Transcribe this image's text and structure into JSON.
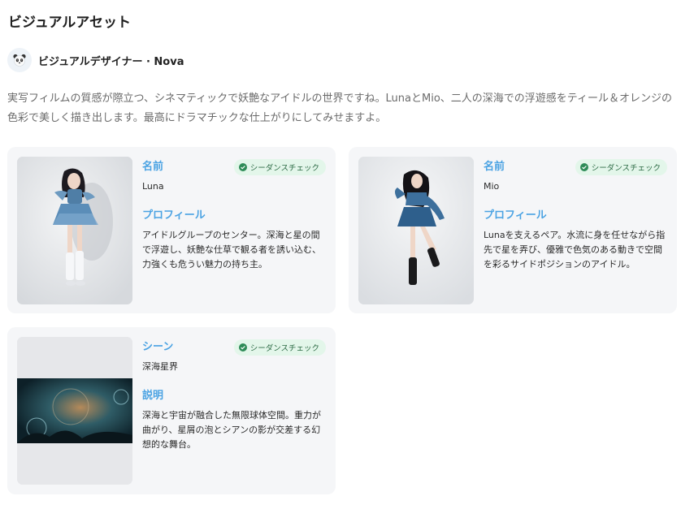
{
  "section": {
    "title": "ビジュアルアセット"
  },
  "designer": {
    "avatar_icon": "panda-icon",
    "name": "ビジュアルデザイナー · Nova"
  },
  "intro": "実写フィルムの質感が際立つ、シネマティックで妖艶なアイドルの世界ですね。LunaとMio、二人の深海での浮遊感をティール＆オレンジの色彩で美しく描き出します。最高にドラマチックな仕上がりにしてみせますよ。",
  "badge_label": "シーダンスチェック",
  "cards": [
    {
      "label1": "名前",
      "value1": "Luna",
      "label2": "プロフィール",
      "value2": "アイドルグループのセンター。深海と星の間で浮遊し、妖艶な仕草で観る者を誘い込む、力強くも危うい魅力の持ち主。"
    },
    {
      "label1": "名前",
      "value1": "Mio",
      "label2": "プロフィール",
      "value2": "Lunaを支えるペア。水流に身を任せながら指先で星を弄び、優雅で色気のある動きで空間を彩るサイドポジションのアイドル。"
    },
    {
      "label1": "シーン",
      "value1": "深海星界",
      "label2": "説明",
      "value2": "深海と宇宙が融合した無限球体空間。重力が曲がり、星屑の泡とシアンの影が交差する幻想的な舞台。"
    }
  ]
}
